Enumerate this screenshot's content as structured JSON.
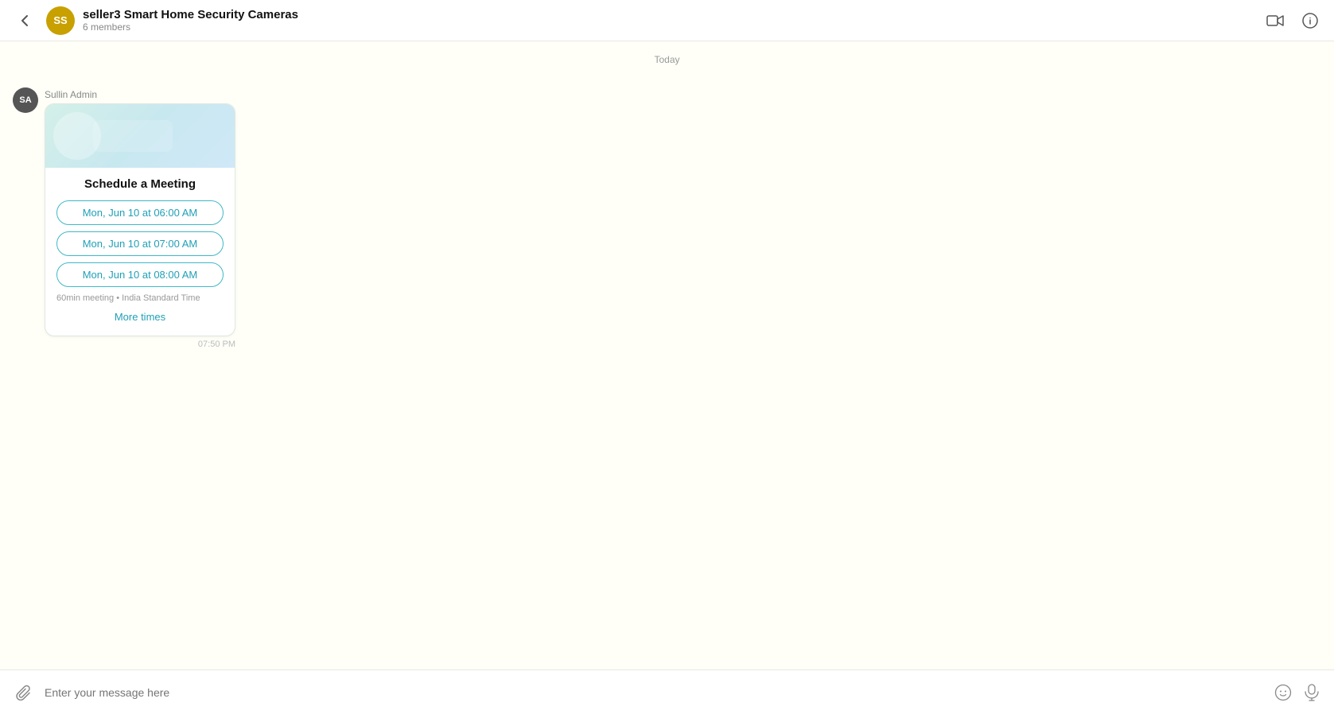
{
  "header": {
    "back_label": "←",
    "avatar_initials": "SS",
    "title": "seller3 Smart Home Security Cameras",
    "members": "6 members",
    "video_icon": "video-camera",
    "info_icon": "info"
  },
  "chat": {
    "date_divider": "Today",
    "message": {
      "sender_initials": "SA",
      "sender_name": "Sullin Admin",
      "card": {
        "title": "Schedule a Meeting",
        "time_slots": [
          "Mon, Jun 10 at 06:00 AM",
          "Mon, Jun 10 at 07:00 AM",
          "Mon, Jun 10 at 08:00 AM"
        ],
        "meta": "60min meeting • India Standard Time",
        "more_times": "More times"
      },
      "timestamp": "07:50 PM"
    }
  },
  "input": {
    "placeholder": "Enter your message here",
    "attach_icon": "📎",
    "emoji_icon": "☺",
    "mic_icon": "🎤"
  }
}
